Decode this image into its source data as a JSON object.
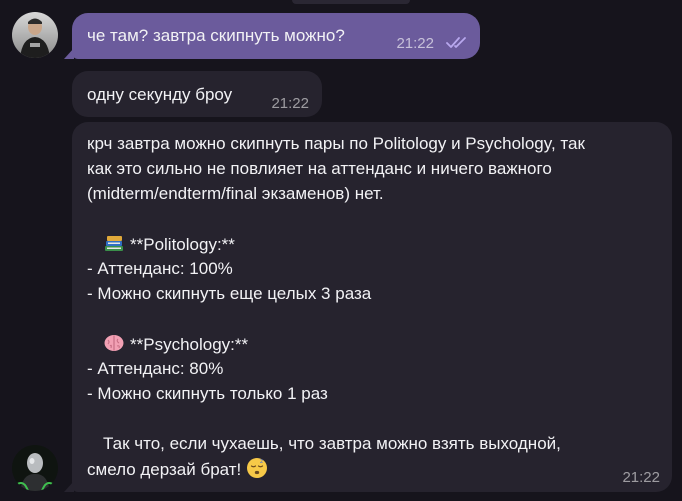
{
  "messages": [
    {
      "sender": "self",
      "text": "че там? завтра скипнуть можно?",
      "time": "21:22",
      "status_icon": "double-check-icon"
    },
    {
      "sender": "bot",
      "text": "одну секунду броу",
      "time": "21:22"
    },
    {
      "sender": "bot",
      "time": "21:22",
      "lines": [
        "крч завтра можно скипнуть пары по Politology и Psychology, так",
        "как это сильно не повлияет на аттенданс и ничего важного",
        "(midterm/endterm/final экзаменов) нет.",
        "",
        "**Politology:**",
        "- Аттенданс: 100%",
        "- Можно скипнуть еще целых 3 раза",
        "",
        "**Psychology:**",
        "- Аттенданс: 80%",
        "- Можно скипнуть только 1 раз",
        "",
        "Так что, если чухаешь, что завтра можно взять выходной,",
        "смело дерзай брат!"
      ],
      "emojis": {
        "politology": "books-icon",
        "psychology": "brain-icon",
        "closing": "sleepy-face-icon"
      }
    }
  ],
  "colors": {
    "background": "#16141c",
    "outgoing_bubble": "#6b5b9c",
    "incoming_bubble": "#26232e",
    "read_checks": "#b8a8ee"
  }
}
